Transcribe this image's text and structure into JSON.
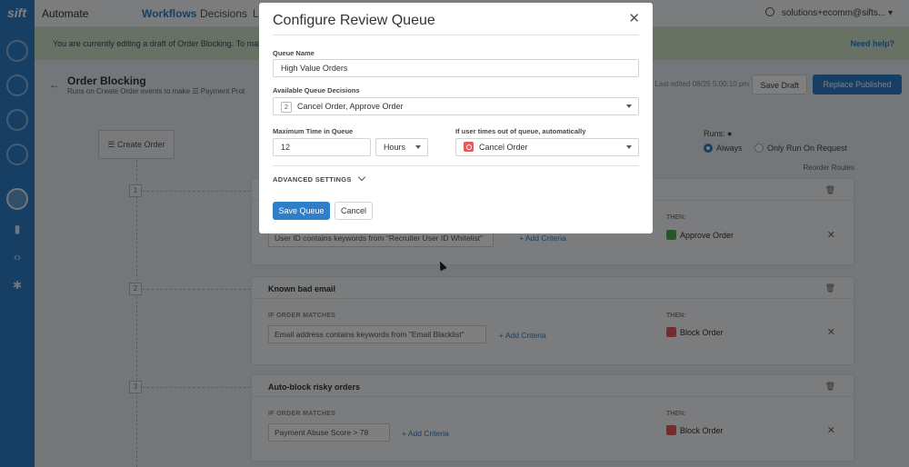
{
  "app": {
    "logo": "sift",
    "name": "Automate"
  },
  "nav": {
    "workflows": "Workflows",
    "decisions": "Decisions",
    "l": "L"
  },
  "user": {
    "email": "solutions+ecomm@sifts...",
    "caret": "▾"
  },
  "banner": {
    "text": "You are currently editing a draft of Order Blocking. To mak",
    "help": "Need help?"
  },
  "header": {
    "back": "←",
    "title": "Order Blocking",
    "subtitle": "Runs on Create Order events to make ☰ Payment Prot",
    "edited": "Last edited 08/25 5:00:10 pm",
    "save_draft": "Save Draft",
    "replace": "Replace Published"
  },
  "workflow": {
    "create_order": "☰ Create Order",
    "runs_label": "Runs: ●",
    "always": "Always",
    "on_request": "Only Run On Request",
    "reorder": "Reorder Routes",
    "routes": [
      {
        "num": "1",
        "name": "",
        "if_label": "",
        "criteria": "User ID contains keywords from \"Recruiter User ID Whitelist\"",
        "add": "+ Add Criteria",
        "then_label": "THEN:",
        "action": "Approve Order",
        "action_color": "#4caf50"
      },
      {
        "num": "2",
        "name": "Known bad email",
        "if_label": "IF ORDER MATCHES",
        "criteria": "Email address contains keywords from \"Email Blacklist\"",
        "add": "+ Add Criteria",
        "then_label": "THEN:",
        "action": "Block Order",
        "action_color": "#e65a5a"
      },
      {
        "num": "3",
        "name": "Auto-block risky orders",
        "if_label": "IF ORDER MATCHES",
        "criteria": "Payment Abuse Score > 78",
        "add": "+ Add Criteria",
        "then_label": "THEN:",
        "action": "Block Order",
        "action_color": "#e65a5a"
      }
    ]
  },
  "modal": {
    "title": "Configure Review Queue",
    "queue_name_label": "Queue Name",
    "queue_name_value": "High Value Orders",
    "decisions_label": "Available Queue Decisions",
    "decisions_count": "2",
    "decisions_value": "Cancel Order, Approve Order",
    "max_time_label": "Maximum Time in Queue",
    "max_time_value": "12",
    "max_time_unit": "Hours",
    "timeout_label": "If user times out of queue, automatically",
    "timeout_value": "Cancel Order",
    "advanced": "ADVANCED SETTINGS",
    "save": "Save Queue",
    "cancel": "Cancel",
    "close": "✕"
  }
}
